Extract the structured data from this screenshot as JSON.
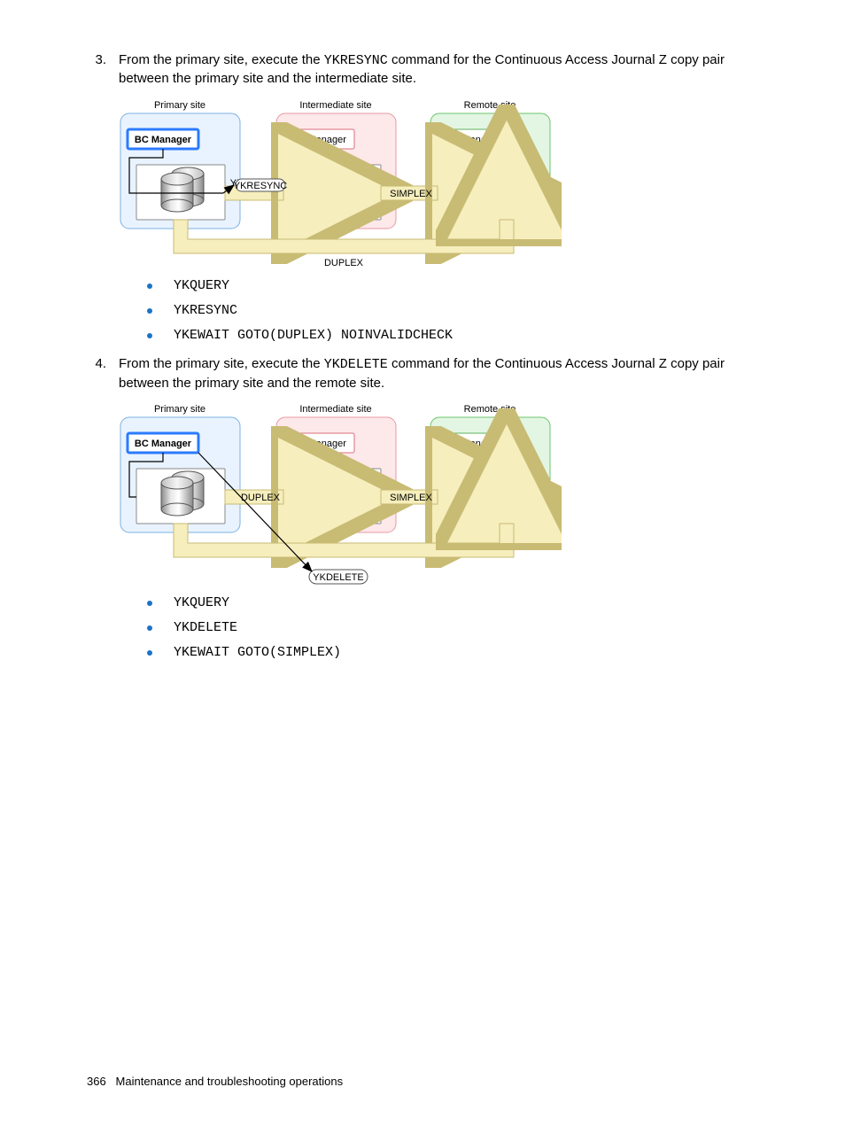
{
  "step3": {
    "num": "3.",
    "text_a": "From the primary site, execute the ",
    "cmd": "YKRESYNC",
    "text_b": " command for the Continuous Access Journal Z copy pair between the primary site and the intermediate site."
  },
  "step4": {
    "num": "4.",
    "text_a": "From the primary site, execute the ",
    "cmd": "YKDELETE",
    "text_b": " command for the Continuous Access Journal Z copy pair between the primary site and the remote site."
  },
  "diagram": {
    "primary": "Primary site",
    "intermediate": "Intermediate site",
    "remote": "Remote site",
    "bcm": "BC Manager",
    "ykresync": "YKRESYNC",
    "simplex": "SIMPLEX",
    "duplex": "DUPLEX",
    "ykdelete": "YKDELETE"
  },
  "bullets3": {
    "b1": "YKQUERY",
    "b2": "YKRESYNC",
    "b3": "YKEWAIT GOTO(DUPLEX) NOINVALIDCHECK"
  },
  "bullets4": {
    "b1": "YKQUERY",
    "b2": "YKDELETE",
    "b3": "YKEWAIT GOTO(SIMPLEX)"
  },
  "footer": {
    "page": "366",
    "title": "Maintenance and troubleshooting operations"
  }
}
